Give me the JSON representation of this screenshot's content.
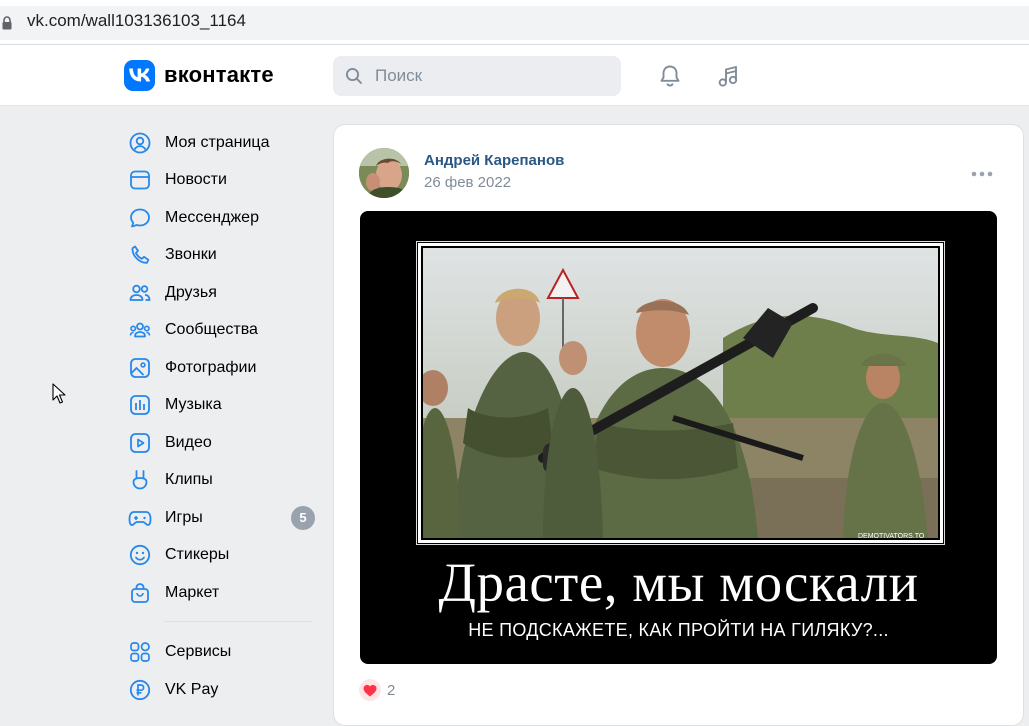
{
  "browser": {
    "url": "vk.com/wall103136103_1164"
  },
  "header": {
    "logo_text": "вконтакте",
    "search_placeholder": "Поиск",
    "icons": [
      "vk-logo-icon",
      "search-icon",
      "bell-icon",
      "music-icon"
    ]
  },
  "sidebar": {
    "items": [
      {
        "label": "Моя страница",
        "icon": "user-circle-icon"
      },
      {
        "label": "Новости",
        "icon": "news-icon"
      },
      {
        "label": "Мессенджер",
        "icon": "message-icon"
      },
      {
        "label": "Звонки",
        "icon": "phone-icon"
      },
      {
        "label": "Друзья",
        "icon": "friends-icon"
      },
      {
        "label": "Сообщества",
        "icon": "communities-icon"
      },
      {
        "label": "Фотографии",
        "icon": "photo-icon"
      },
      {
        "label": "Музыка",
        "icon": "music-bars-icon"
      },
      {
        "label": "Видео",
        "icon": "video-icon"
      },
      {
        "label": "Клипы",
        "icon": "clips-icon"
      },
      {
        "label": "Игры",
        "icon": "gamepad-icon",
        "badge": "5"
      },
      {
        "label": "Стикеры",
        "icon": "smile-icon"
      },
      {
        "label": "Маркет",
        "icon": "bag-icon"
      }
    ],
    "items2": [
      {
        "label": "Сервисы",
        "icon": "services-icon"
      },
      {
        "label": "VK Pay",
        "icon": "ruble-icon"
      }
    ]
  },
  "post": {
    "author": "Андрей Карепанов",
    "date": "26 фев 2022",
    "image": {
      "title": "Драсте, мы москали",
      "subtitle": "НЕ ПОДСКАЖЕТЕ, КАК ПРОЙТИ НА ГИЛЯКУ?...",
      "watermark": "DEMOTIVATORS.TO"
    },
    "likes": "2"
  },
  "colors": {
    "accent": "#0077ff",
    "link": "#2a5885",
    "muted": "#818c99",
    "badge": "#99a2ad",
    "like": "#ff3347"
  }
}
